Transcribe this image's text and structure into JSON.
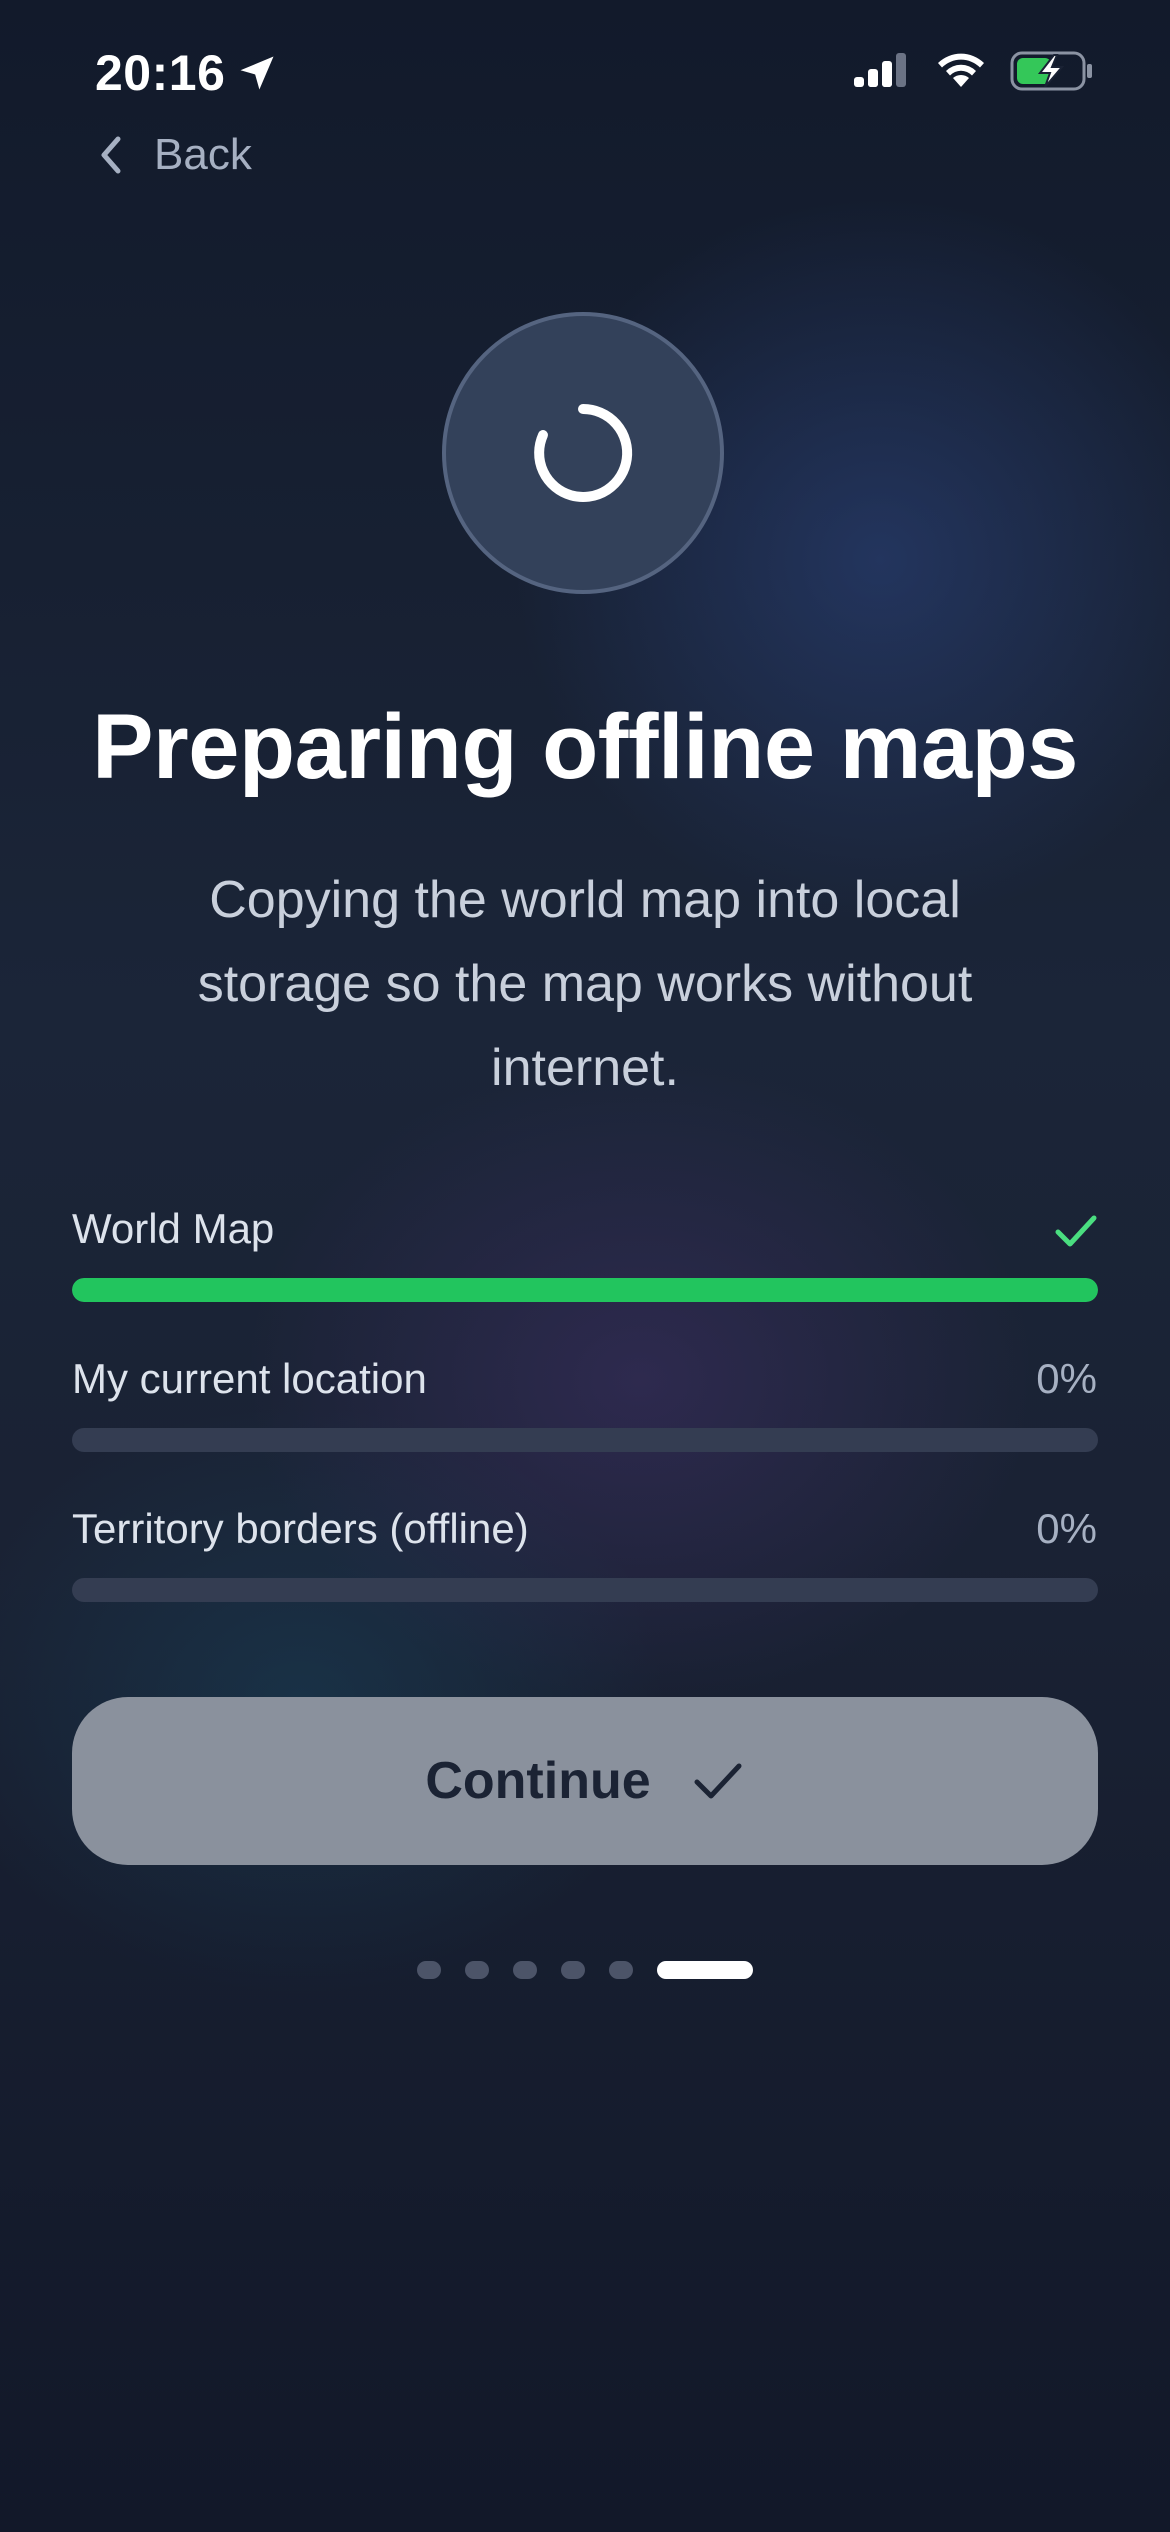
{
  "status_bar": {
    "time": "20:16",
    "icons": [
      "location-arrow-icon",
      "signal-icon",
      "wifi-icon",
      "battery-charging-icon"
    ]
  },
  "nav": {
    "back_label": "Back",
    "icon": "chevron-left-icon"
  },
  "header": {
    "icon": "loading-spinner-icon",
    "title": "Preparing offline maps",
    "subtitle_lines": [
      "Copying the world map into local",
      "storage so the map works without",
      "internet."
    ]
  },
  "progress_items": [
    {
      "label": "World Map",
      "value": "",
      "status": "complete",
      "progress": 1.0,
      "icon": "checkmark-icon"
    },
    {
      "label": "My current location",
      "value": "0%",
      "status": "pending",
      "progress": 0.0
    },
    {
      "label": "Territory borders (offline)",
      "value": "0%",
      "status": "pending",
      "progress": 0.0
    }
  ],
  "continue_button": {
    "label": "Continue",
    "icon": "checkmark-icon"
  },
  "pager": {
    "total": 6,
    "active_index": 5
  },
  "colors": {
    "accent_green": "#22c55e",
    "check_green": "#4ade80",
    "button_bg": "#8a919d",
    "button_text": "#1b2334",
    "track": "#343d52"
  }
}
